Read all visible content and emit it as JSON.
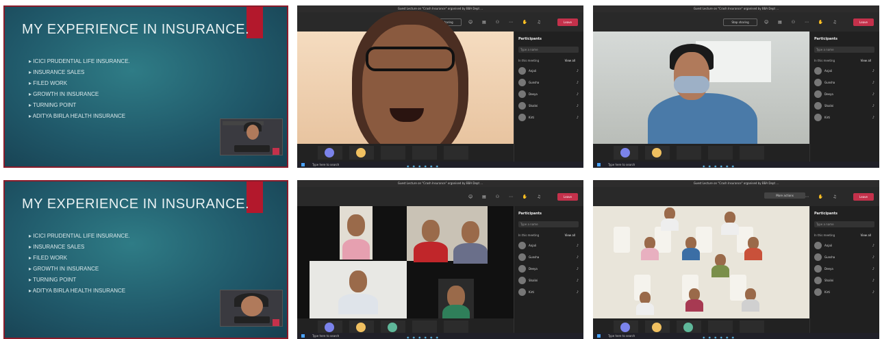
{
  "slide": {
    "title": "MY EXPERIENCE IN INSURANCE.",
    "bullets": [
      "ICICI PRUDENTIAL LIFE INSURANCE.",
      "INSURANCE SALES",
      "FILED WORK",
      "GROWTH IN INSURANCE",
      "TURNING POINT",
      "ADITYA BIRLA HEALTH INSURANCE"
    ]
  },
  "teams": {
    "title_a": "Guest Lecture on \"Crash Insurance\" organised by BBA Dept ...",
    "title_b": "Guest Lecture on \"Crash Insurance\" organised by BBA Dept ...",
    "share_label": "Stop sharing",
    "leave_label": "Leave",
    "participants_header": "Participants",
    "search_placeholder": "Type a name",
    "section_label": "In this meeting",
    "view_all": "View all",
    "participants": [
      "Anjali",
      "Gunsha",
      "Deeya",
      "Shalini",
      "Kirti"
    ],
    "more_option_tooltip": "More actions",
    "taskbar_search": "Type here to search"
  }
}
